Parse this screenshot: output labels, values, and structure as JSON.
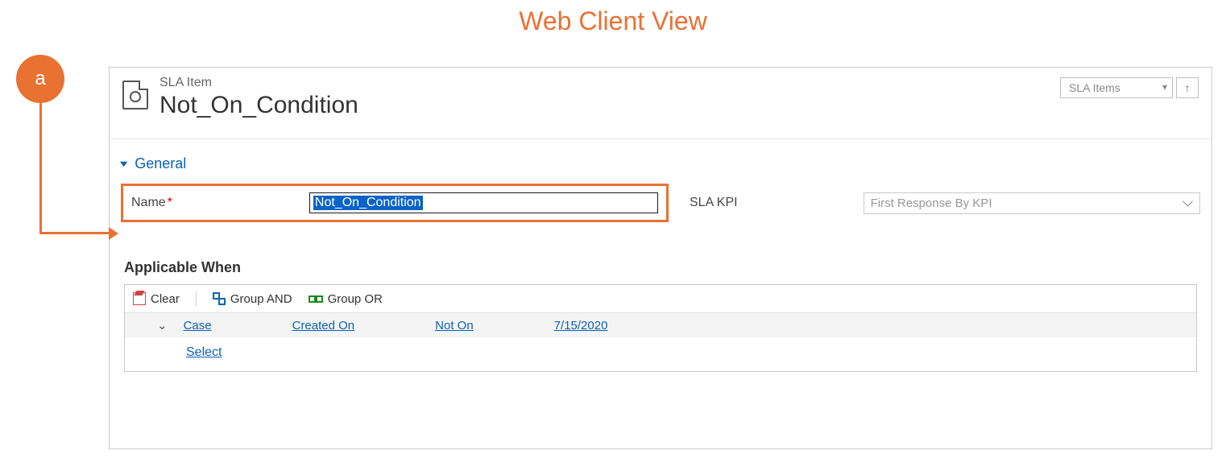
{
  "page_heading": "Web Client View",
  "annotation_label": "a",
  "header": {
    "entity_type": "SLA Item",
    "record_title": "Not_On_Condition",
    "view_selector": "SLA Items"
  },
  "general_section": {
    "title": "General",
    "name_label": "Name",
    "name_value": "Not_On_Condition",
    "sla_kpi_label": "SLA KPI",
    "sla_kpi_value": "First Response By KPI"
  },
  "applicable_when": {
    "title": "Applicable When",
    "toolbar": {
      "clear": "Clear",
      "group_and": "Group AND",
      "group_or": "Group OR"
    },
    "condition_row": {
      "entity": "Case",
      "attribute": "Created On",
      "operator": "Not On",
      "value": "7/15/2020"
    },
    "select_link": "Select"
  }
}
